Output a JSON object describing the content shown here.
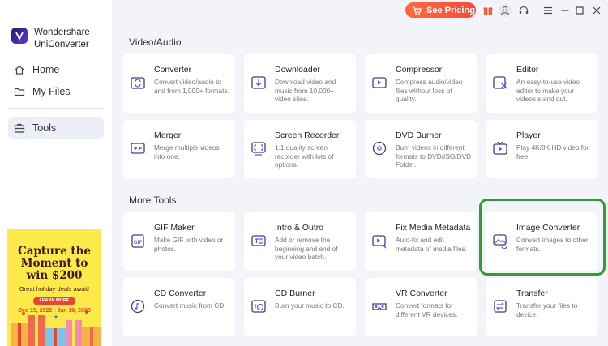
{
  "app": {
    "name": "Wondershare UniConverter"
  },
  "titlebar": {
    "pricing_label": "See Pricing"
  },
  "sidebar": {
    "items": [
      {
        "label": "Home",
        "icon": "home-icon"
      },
      {
        "label": "My Files",
        "icon": "folder-icon"
      },
      {
        "label": "Tools",
        "icon": "toolbox-icon",
        "active": true
      }
    ]
  },
  "promo": {
    "headline_1": "Capture the",
    "headline_2": "Moment to",
    "headline_3": "win $200",
    "subtitle": "Great holiday deals await!",
    "button": "LEARN MORE",
    "dates": "Dec 15, 2022 - Jan 10, 2023"
  },
  "sections": {
    "video_audio": {
      "title": "Video/Audio",
      "cards": [
        {
          "title": "Converter",
          "desc": "Convert video/audio to and from 1,000+ formats.",
          "icon": "converter-icon"
        },
        {
          "title": "Downloader",
          "desc": "Download video and music from 10,000+ video sites.",
          "icon": "downloader-icon"
        },
        {
          "title": "Compressor",
          "desc": "Compress audio/video files without loss of quality.",
          "icon": "compressor-icon"
        },
        {
          "title": "Editor",
          "desc": "An easy-to-use video editor to make your videos stand out.",
          "icon": "editor-icon"
        },
        {
          "title": "Merger",
          "desc": "Merge multiple videos into one.",
          "icon": "merger-icon"
        },
        {
          "title": "Screen Recorder",
          "desc": "1:1 quality screen recorder with lots of options.",
          "icon": "screen-recorder-icon"
        },
        {
          "title": "DVD Burner",
          "desc": "Burn videos in different formats to DVD/ISO/DVD Folder.",
          "icon": "dvd-burner-icon"
        },
        {
          "title": "Player",
          "desc": "Play 4K/8K HD video for free.",
          "icon": "player-icon"
        }
      ]
    },
    "more_tools": {
      "title": "More Tools",
      "cards": [
        {
          "title": "GIF Maker",
          "desc": "Make GIF with video or photos.",
          "icon": "gif-maker-icon"
        },
        {
          "title": "Intro & Outro",
          "desc": "Add or remove the beginning and end of your video batch.",
          "icon": "intro-outro-icon"
        },
        {
          "title": "Fix Media Metadata",
          "desc": "Auto-fix and edit metadata of media files.",
          "icon": "metadata-icon"
        },
        {
          "title": "Image Converter",
          "desc": "Convert images to other formats.",
          "icon": "image-converter-icon"
        },
        {
          "title": "CD Converter",
          "desc": "Convert music from CD.",
          "icon": "cd-converter-icon"
        },
        {
          "title": "CD Burner",
          "desc": "Burn your music to CD.",
          "icon": "cd-burner-icon"
        },
        {
          "title": "VR Converter",
          "desc": "Convert formats for different VR devices.",
          "icon": "vr-converter-icon"
        },
        {
          "title": "Transfer",
          "desc": "Transfer your files to device.",
          "icon": "transfer-icon"
        }
      ]
    }
  },
  "colors": {
    "accent": "#f55a3a",
    "highlight": "#2e9e2e",
    "promo_bg": "#fde94a"
  }
}
